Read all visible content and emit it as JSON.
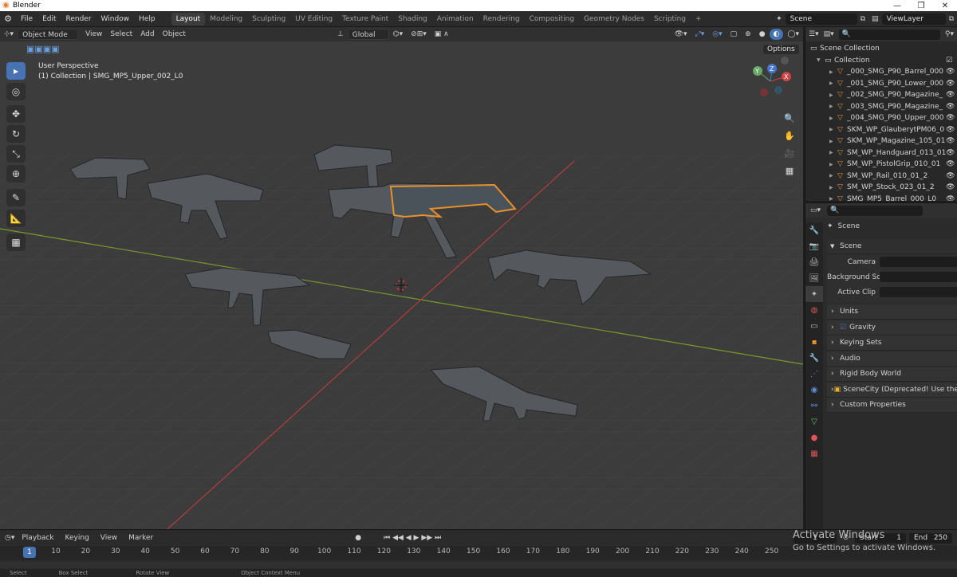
{
  "window": {
    "title": "Blender",
    "min": "—",
    "max": "❐",
    "close": "✕"
  },
  "menubar": {
    "items": [
      "File",
      "Edit",
      "Render",
      "Window",
      "Help"
    ]
  },
  "workspaces": [
    "Layout",
    "Modeling",
    "Sculpting",
    "UV Editing",
    "Texture Paint",
    "Shading",
    "Animation",
    "Rendering",
    "Compositing",
    "Geometry Nodes",
    "Scripting"
  ],
  "active_workspace": "Layout",
  "add_workspace": "+",
  "scene_selector": "Scene",
  "view_layer": "ViewLayer",
  "viewport_header": {
    "mode": "Object Mode",
    "menus": [
      "View",
      "Select",
      "Add",
      "Object"
    ],
    "orientation": "Global",
    "options": "Options"
  },
  "viewport": {
    "perspective": "User Perspective",
    "context": "(1) Collection | SMG_MP5_Upper_002_L0"
  },
  "gizmo": {
    "x": "X",
    "y": "Y",
    "z": "Z"
  },
  "outliner": {
    "root": "Scene Collection",
    "collection": "Collection",
    "items": [
      "_000_SMG_P90_Barrel_000",
      "_001_SMG_P90_Lower_000",
      "_002_SMG_P90_Magazine_",
      "_003_SMG_P90_Magazine_",
      "_004_SMG_P90_Upper_000",
      "SKM_WP_GlauberytPM06_0",
      "SKM_WP_Magazine_105_01",
      "SM_WP_Handguard_013_01",
      "SM_WP_PistolGrip_010_01",
      "SM_WP_Rail_010_01_2",
      "SM_WP_Stock_023_01_2",
      "SMG_MP5_Barrel_000_L0"
    ]
  },
  "properties": {
    "header": "Scene",
    "section": "Scene",
    "fields": [
      {
        "label": "Camera"
      },
      {
        "label": "Background Sce..."
      },
      {
        "label": "Active Clip"
      }
    ],
    "panels": [
      "Units",
      "Gravity",
      "Keying Sets",
      "Audio",
      "Rigid Body World",
      "SceneCity (Deprecated! Use the node",
      "Custom Properties"
    ]
  },
  "timeline": {
    "menus": [
      "Playback",
      "Keying",
      "View",
      "Marker"
    ],
    "current_frame": "1",
    "start_label": "Start",
    "start": "1",
    "end_label": "End",
    "end": "250",
    "ticks": [
      "10",
      "20",
      "30",
      "40",
      "50",
      "60",
      "70",
      "80",
      "90",
      "100",
      "110",
      "120",
      "130",
      "140",
      "150",
      "160",
      "170",
      "180",
      "190",
      "200",
      "210",
      "220",
      "230",
      "240",
      "250"
    ],
    "playhead": "1"
  },
  "statusbar": [
    "Select",
    "Box Select",
    "Rotate View",
    "Object Context Menu"
  ],
  "watermark": {
    "line1": "Activate Windows",
    "line2": "Go to Settings to activate Windows."
  },
  "colors": {
    "accent": "#4772b3",
    "selection": "#e8902a",
    "x_axis": "#b43c3c",
    "y_axis": "#7a9a2a"
  }
}
